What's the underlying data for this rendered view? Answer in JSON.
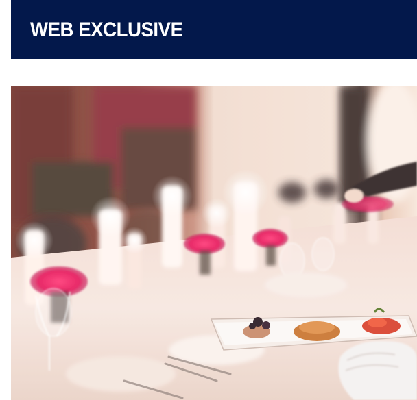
{
  "banner": {
    "title": "WEB EXCLUSIVE",
    "background_color": "#03184b",
    "text_color": "#ffffff"
  },
  "photo": {
    "subject": "dinner-party-table-image"
  }
}
